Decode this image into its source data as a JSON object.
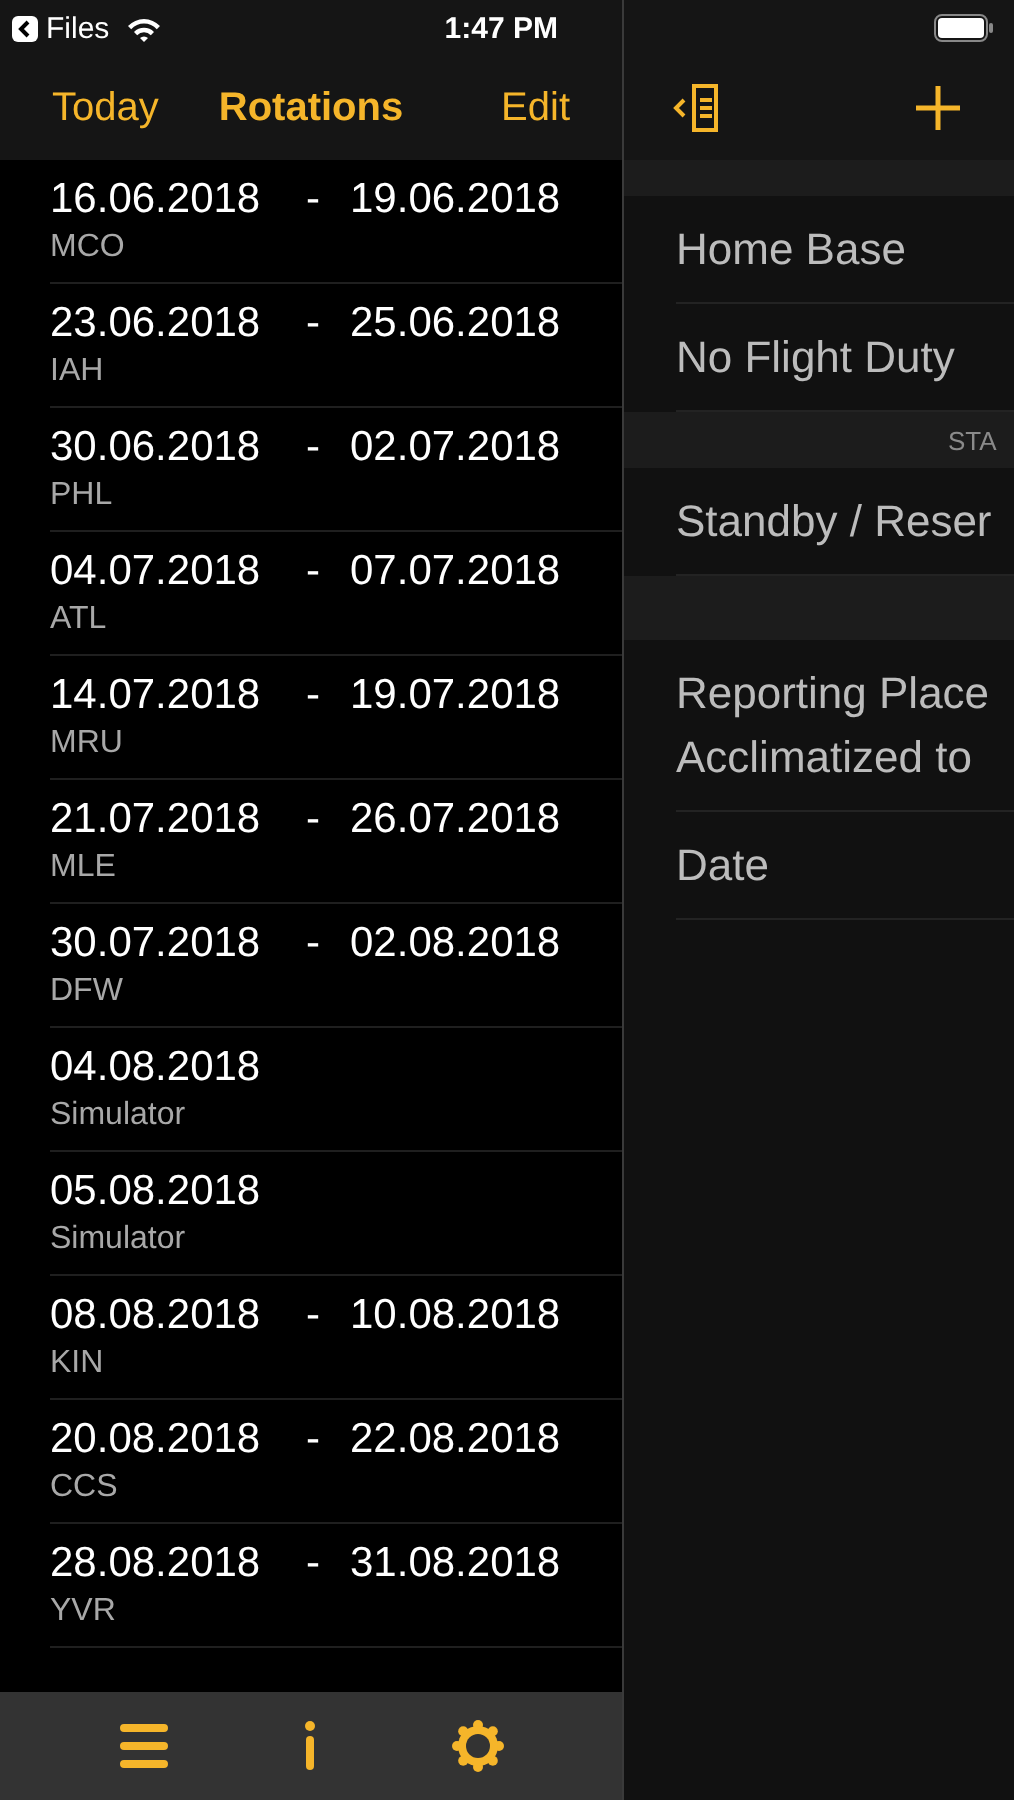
{
  "status_bar": {
    "back_label": "Files",
    "time": "1:47 PM"
  },
  "nav": {
    "left_button": "Today",
    "title": "Rotations",
    "right_button": "Edit"
  },
  "rotations": [
    {
      "start": "16.06.2018",
      "separator": "-",
      "end": "19.06.2018",
      "place": "MCO"
    },
    {
      "start": "23.06.2018",
      "separator": "-",
      "end": "25.06.2018",
      "place": "IAH"
    },
    {
      "start": "30.06.2018",
      "separator": "-",
      "end": "02.07.2018",
      "place": "PHL"
    },
    {
      "start": "04.07.2018",
      "separator": "-",
      "end": "07.07.2018",
      "place": "ATL"
    },
    {
      "start": "14.07.2018",
      "separator": "-",
      "end": "19.07.2018",
      "place": "MRU"
    },
    {
      "start": "21.07.2018",
      "separator": "-",
      "end": "26.07.2018",
      "place": "MLE"
    },
    {
      "start": "30.07.2018",
      "separator": "-",
      "end": "02.08.2018",
      "place": "DFW"
    },
    {
      "start": "04.08.2018",
      "place": "Simulator"
    },
    {
      "start": "05.08.2018",
      "place": "Simulator"
    },
    {
      "start": "08.08.2018",
      "separator": "-",
      "end": "10.08.2018",
      "place": "KIN"
    },
    {
      "start": "20.08.2018",
      "separator": "-",
      "end": "22.08.2018",
      "place": "CCS"
    },
    {
      "start": "28.08.2018",
      "separator": "-",
      "end": "31.08.2018",
      "place": "YVR"
    }
  ],
  "detail": {
    "sections": [
      {
        "rows": [
          {
            "label": "Home Base"
          },
          {
            "label": "No Flight Duty"
          }
        ]
      },
      {
        "header": "STA",
        "rows": [
          {
            "label": "Standby / Reser"
          }
        ]
      },
      {
        "rows": [
          {
            "label": "Reporting Place",
            "sublabel": "Acclimatized to"
          },
          {
            "label": "Date"
          }
        ]
      }
    ]
  }
}
